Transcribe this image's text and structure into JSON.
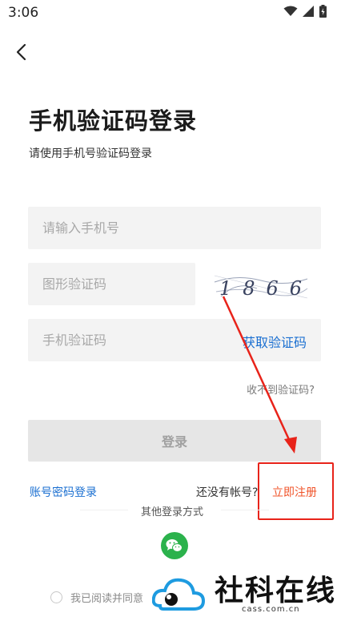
{
  "status_bar": {
    "time": "3:06"
  },
  "header": {
    "title": "手机验证码登录",
    "subtitle": "请使用手机号验证码登录"
  },
  "form": {
    "phone_placeholder": "请输入手机号",
    "image_code_placeholder": "图形验证码",
    "captcha_text": "1866",
    "sms_code_placeholder": "手机验证码",
    "get_code_label": "获取验证码",
    "no_code_label": "收不到验证码?",
    "login_label": "登录"
  },
  "links": {
    "password_login": "账号密码登录",
    "no_account": "还没有帐号?",
    "register": "立即注册"
  },
  "other_login": {
    "title": "其他登录方式",
    "icons": [
      "wechat-icon"
    ]
  },
  "agreement": {
    "text": "我已阅读并同意"
  },
  "watermark": {
    "brand": "社科在线",
    "url": "cass.com.cn"
  },
  "colors": {
    "accent": "#1a6fd1",
    "register": "#f0542a",
    "annotation": "#e8231a",
    "wechat": "#2bb24c"
  }
}
